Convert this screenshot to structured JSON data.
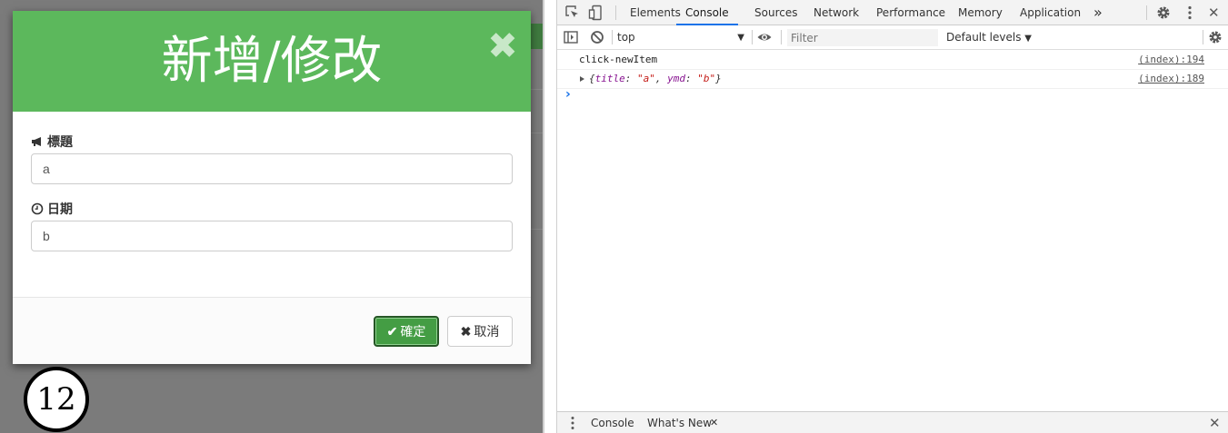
{
  "modal": {
    "title": "新增/修改",
    "close_glyph": "✖",
    "fields": [
      {
        "label": "標題",
        "icon": "bullhorn-icon",
        "value": "a"
      },
      {
        "label": "日期",
        "icon": "clock-icon",
        "value": "b"
      }
    ],
    "confirm_label": "確定",
    "cancel_label": "取消",
    "confirm_color": "#449d44",
    "header_color": "#5cb85c"
  },
  "badge": {
    "text": "12"
  },
  "devtools": {
    "tabs": [
      "Elements",
      "Console",
      "Sources",
      "Network",
      "Performance",
      "Memory",
      "Application"
    ],
    "active_tab": "Console",
    "more_glyph": "»",
    "context": "top",
    "filter_placeholder": "Filter",
    "levels": "Default levels",
    "logs": [
      {
        "message": "click-newItem",
        "source": "(index):194"
      },
      {
        "key1": "title",
        "val1": "\"a\"",
        "key2": "ymd",
        "val2": "\"b\"",
        "source": "(index):189"
      }
    ],
    "prompt": "›",
    "drawer_tabs": [
      "Console",
      "What's New"
    ],
    "close_glyph": "✕"
  }
}
